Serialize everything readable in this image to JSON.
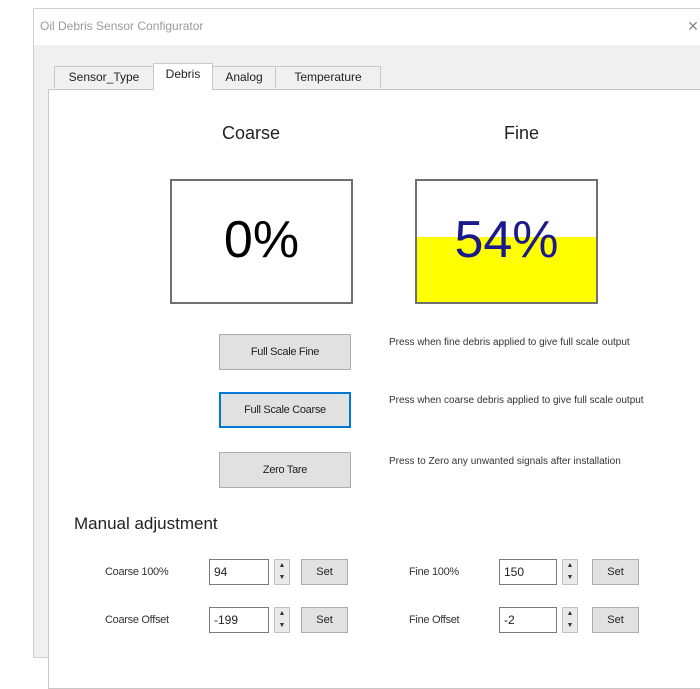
{
  "window": {
    "title": "Oil Debris Sensor Configurator",
    "close_glyph": "✕"
  },
  "tabs": [
    {
      "label": "Sensor_Type",
      "active": false
    },
    {
      "label": "Debris",
      "active": true
    },
    {
      "label": "Analog",
      "active": false
    },
    {
      "label": "Temperature",
      "active": false
    }
  ],
  "gauges": {
    "coarse": {
      "label": "Coarse",
      "value_text": "0%",
      "fill_fraction": 0.0,
      "text_color": "#000000"
    },
    "fine": {
      "label": "Fine",
      "value_text": "54%",
      "fill_fraction": 0.54,
      "text_color": "#1a1a8c",
      "fill_color": "#ffff00"
    }
  },
  "actions": [
    {
      "label": "Full Scale Fine",
      "description": "Press when fine debris applied to give full scale output"
    },
    {
      "label": "Full Scale Coarse",
      "description": "Press when coarse debris applied to give full scale output"
    },
    {
      "label": "Zero Tare",
      "description": "Press to Zero any unwanted signals after installation"
    }
  ],
  "manual": {
    "title": "Manual adjustment",
    "set_label": "Set",
    "coarse_100": {
      "label": "Coarse 100%",
      "value": "94"
    },
    "coarse_offset": {
      "label": "Coarse Offset",
      "value": "-199"
    },
    "fine_100": {
      "label": "Fine 100%",
      "value": "150"
    },
    "fine_offset": {
      "label": "Fine Offset",
      "value": "-2"
    }
  },
  "colors": {
    "focus_accent": "#0078d7",
    "gauge_fill": "#ffff00"
  },
  "icons": {
    "spin_up": "▲",
    "spin_down": "▼"
  }
}
